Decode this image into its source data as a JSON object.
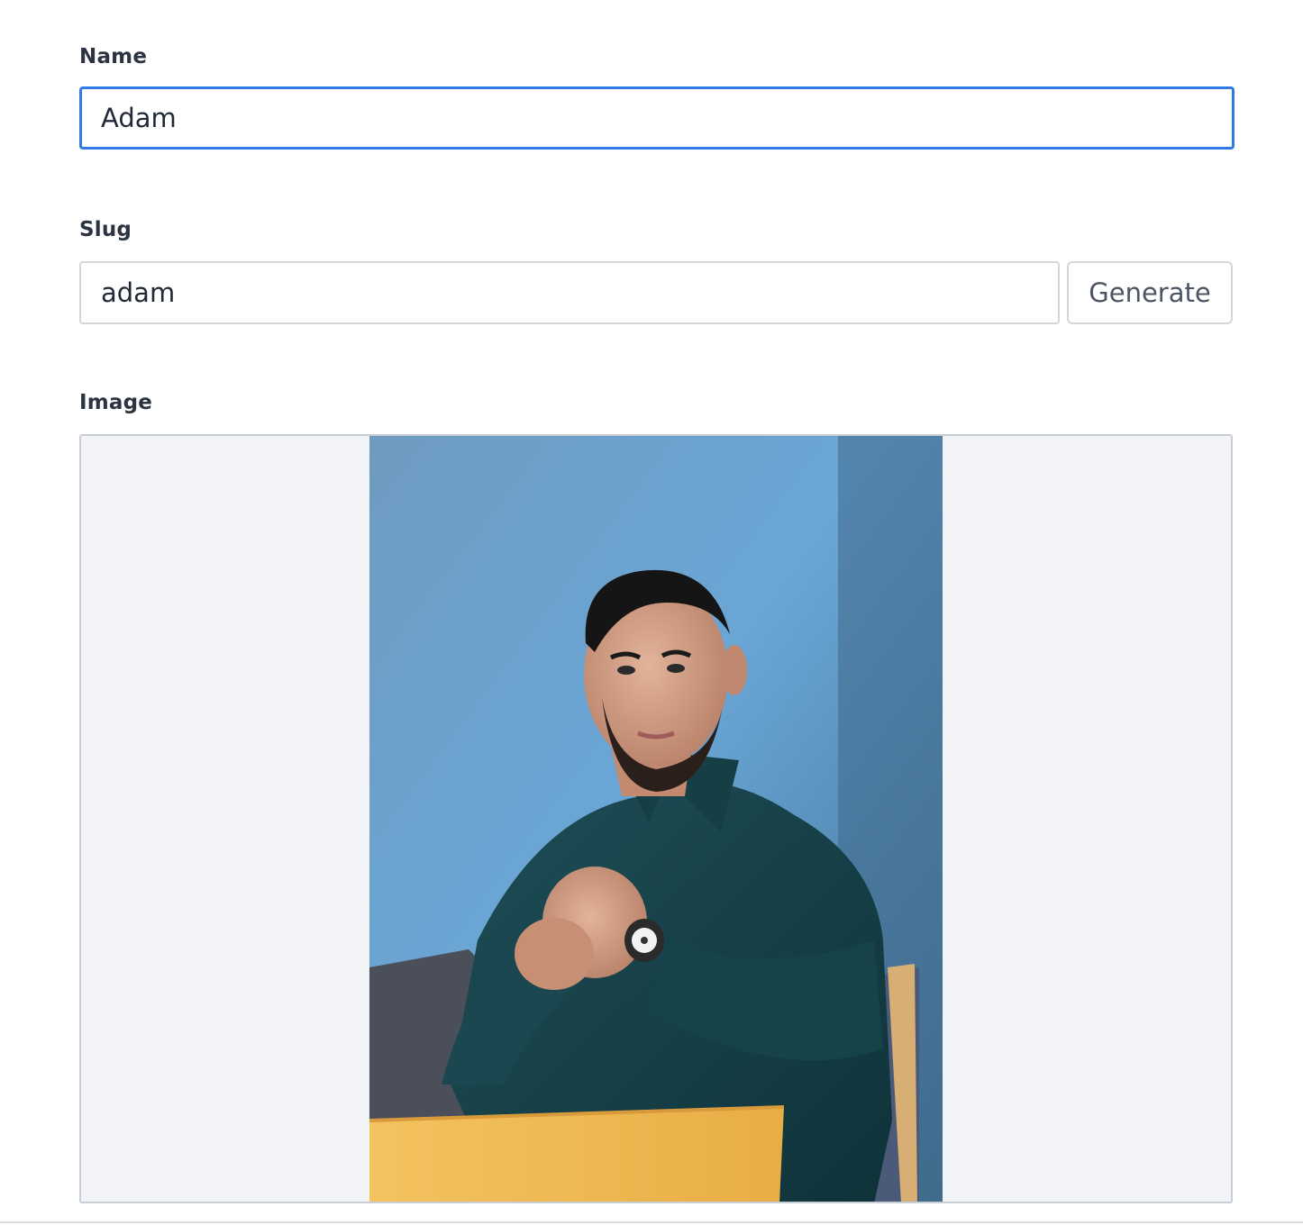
{
  "fields": {
    "name": {
      "label": "Name",
      "value": "Adam"
    },
    "slug": {
      "label": "Slug",
      "value": "adam",
      "generate_label": "Generate"
    },
    "image": {
      "label": "Image"
    }
  },
  "colors": {
    "focus_border": "#2f7ae5",
    "input_border": "#d3d7dc",
    "image_background": "#f1f3f6",
    "label_text": "#2b3441"
  },
  "icons": []
}
